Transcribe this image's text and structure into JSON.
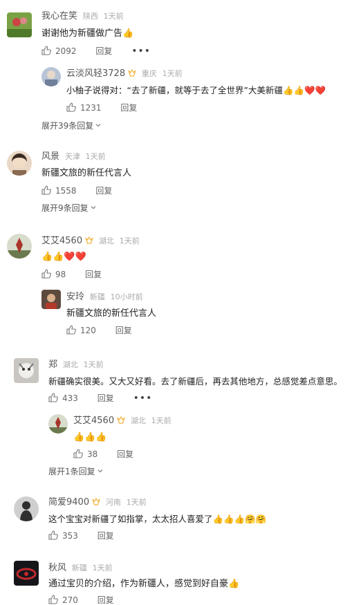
{
  "comments": [
    {
      "name": "我心在笑",
      "location": "陕西",
      "time": "1天前",
      "vip": false,
      "text": "谢谢他为新疆做广告👍",
      "likes": "2092",
      "reply_label": "回复",
      "has_more": true,
      "replies": [
        {
          "name": "云淡风轻3728",
          "location": "重庆",
          "time": "1天前",
          "vip": true,
          "text": "小柚子说得对：“去了新疆，就等于去了全世界”大美新疆👍👍❤️❤️",
          "likes": "1231",
          "reply_label": "回复"
        }
      ],
      "expand_label": "展开39条回复"
    },
    {
      "name": "风景",
      "location": "天津",
      "time": "1天前",
      "vip": false,
      "text": "新疆文旅的新任代言人",
      "likes": "1558",
      "reply_label": "回复",
      "replies": [],
      "expand_label": "展开9条回复"
    },
    {
      "name": "艾艾4560",
      "location": "湖北",
      "time": "1天前",
      "vip": true,
      "text": "👍👍❤️❤️",
      "likes": "98",
      "reply_label": "回复",
      "replies": [
        {
          "name": "安玲",
          "location": "新疆",
          "time": "10小时前",
          "vip": false,
          "text": "新疆文旅的新任代言人",
          "likes": "120",
          "reply_label": "回复"
        }
      ]
    },
    {
      "name": "郑",
      "location": "湖北",
      "time": "1天前",
      "vip": false,
      "text": "新疆确实很美。又大又好看。去了新疆后，再去其他地方，总感觉差点意思。",
      "likes": "433",
      "reply_label": "回复",
      "has_more": true,
      "replies": [
        {
          "name": "艾艾4560",
          "location": "湖北",
          "time": "1天前",
          "vip": true,
          "text": "👍👍👍",
          "likes": "38",
          "reply_label": "回复"
        }
      ],
      "expand_label": "展开1条回复"
    },
    {
      "name": "简爱9400",
      "location": "河南",
      "time": "1天前",
      "vip": true,
      "text": "这个宝宝对新疆了如指掌，太太招人喜爱了👍👍👍🤗🤗",
      "likes": "353",
      "reply_label": "回复",
      "replies": []
    },
    {
      "name": "秋风",
      "location": "新疆",
      "time": "1天前",
      "vip": false,
      "text": "通过宝贝的介绍，作为新疆人，感觉到好自豪👍",
      "likes": "270",
      "reply_label": "回复",
      "replies": []
    }
  ],
  "colors": {
    "accent_vip": "#f2b23a",
    "meta_gray": "#aaaaaa",
    "text_dark": "#222222"
  },
  "icons": {
    "like": "thumbs-up-icon",
    "more": "more-dots-icon",
    "expand": "chevron-down-icon",
    "vip": "vip-badge-icon"
  }
}
